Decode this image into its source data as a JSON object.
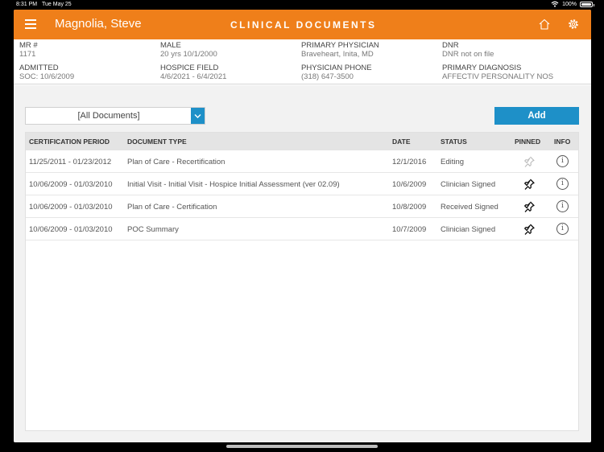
{
  "status_bar": {
    "time": "8:31 PM",
    "date": "Tue May 25",
    "battery": "100%"
  },
  "header": {
    "patient_name": "Magnolia, Steve",
    "title": "CLINICAL DOCUMENTS"
  },
  "patient_info": {
    "mr_label": "MR #",
    "mr_value": "1171",
    "admitted_label": "ADMITTED",
    "admitted_value": "SOC: 10/6/2009",
    "gender_label": "MALE",
    "gender_value": "20 yrs  10/1/2000",
    "hospice_label": "HOSPICE FIELD",
    "hospice_value": "4/6/2021 - 6/4/2021",
    "physician_label": "PRIMARY PHYSICIAN",
    "physician_value": "Braveheart, Inita, MD",
    "phone_label": "PHYSICIAN PHONE",
    "phone_value": "(318) 647-3500",
    "dnr_label": "DNR",
    "dnr_value": "DNR not on file",
    "diagnosis_label": "PRIMARY DIAGNOSIS",
    "diagnosis_value": "AFFECTIV PERSONALITY NOS"
  },
  "filter": {
    "selected": "[All Documents]"
  },
  "add_label": "Add",
  "table": {
    "headers": {
      "period": "CERTIFICATION PERIOD",
      "type": "DOCUMENT TYPE",
      "date": "DATE",
      "status": "STATUS",
      "pinned": "PINNED",
      "info": "INFO"
    },
    "rows": [
      {
        "period": "11/25/2011 - 01/23/2012",
        "type": "Plan of Care - Recertification",
        "date": "12/1/2016",
        "status": "Editing",
        "pinned": false
      },
      {
        "period": "10/06/2009 - 01/03/2010",
        "type": "Initial Visit - Initial Visit - Hospice Initial Assessment (ver 02.09)",
        "date": "10/6/2009",
        "status": "Clinician Signed",
        "pinned": true
      },
      {
        "period": "10/06/2009 - 01/03/2010",
        "type": "Plan of Care - Certification",
        "date": "10/8/2009",
        "status": "Received Signed",
        "pinned": true
      },
      {
        "period": "10/06/2009 - 01/03/2010",
        "type": "POC Summary",
        "date": "10/7/2009",
        "status": "Clinician Signed",
        "pinned": true
      }
    ]
  },
  "icons": {
    "menu": "menu-icon",
    "home": "home-icon",
    "settings": "gear-icon",
    "dropdown": "chevron-down-icon",
    "pin": "pin-icon",
    "info": "info-icon",
    "wifi": "wifi-icon",
    "battery": "battery-icon"
  },
  "colors": {
    "header": "#ef7f1a",
    "accent": "#1e90c8"
  }
}
